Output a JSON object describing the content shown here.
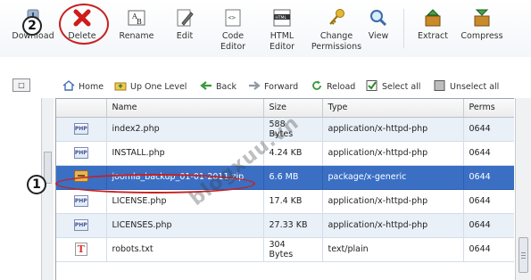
{
  "toolbar": {
    "items": [
      {
        "label": "Download",
        "icon": "download-icon"
      },
      {
        "label": "Delete",
        "icon": "delete-x-icon"
      },
      {
        "label": "Rename",
        "icon": "rename-icon"
      },
      {
        "label": "Edit",
        "icon": "edit-pencil-icon"
      },
      {
        "label": "Code\nEditor",
        "icon": "code-editor-icon"
      },
      {
        "label": "HTML\nEditor",
        "icon": "html-editor-icon"
      },
      {
        "label": "Change\nPermissions",
        "icon": "key-icon"
      },
      {
        "label": "View",
        "icon": "magnifier-icon"
      },
      {
        "label": "Extract",
        "icon": "extract-box-icon"
      },
      {
        "label": "Compress",
        "icon": "compress-box-icon"
      }
    ]
  },
  "nav": {
    "tree_button": "□",
    "home": "Home",
    "up_one_level": "Up One Level",
    "back": "Back",
    "forward": "Forward",
    "reload": "Reload",
    "select_all": "Select all",
    "unselect_all": "Unselect all"
  },
  "table": {
    "columns": [
      "Name",
      "Size",
      "Type",
      "Perms"
    ],
    "rows": [
      {
        "icon": "php-file-icon",
        "name": "index2.php",
        "size": "588\nBytes",
        "type": "application/x-httpd-php",
        "perms": "0644"
      },
      {
        "icon": "php-file-icon",
        "name": "INSTALL.php",
        "size": "4.24 KB",
        "type": "application/x-httpd-php",
        "perms": "0644"
      },
      {
        "icon": "zip-package-icon",
        "name": "joomla_backup_01-01-2011.zip",
        "size": "6.6 MB",
        "type": "package/x-generic",
        "perms": "0644",
        "selected": true
      },
      {
        "icon": "php-file-icon",
        "name": "LICENSE.php",
        "size": "17.4 KB",
        "type": "application/x-httpd-php",
        "perms": "0644"
      },
      {
        "icon": "php-file-icon",
        "name": "LICENSES.php",
        "size": "27.33 KB",
        "type": "application/x-httpd-php",
        "perms": "0644"
      },
      {
        "icon": "text-file-icon",
        "name": "robots.txt",
        "size": "304\nBytes",
        "type": "text/plain",
        "perms": "0644"
      }
    ]
  },
  "annotations": {
    "step1": "1",
    "step2": "2",
    "watermark": "blogxuu.vn"
  },
  "colors": {
    "selected_row": "#3a6fc4",
    "alt_row": "#e9f0f8",
    "annotation_ring": "#c62020"
  }
}
